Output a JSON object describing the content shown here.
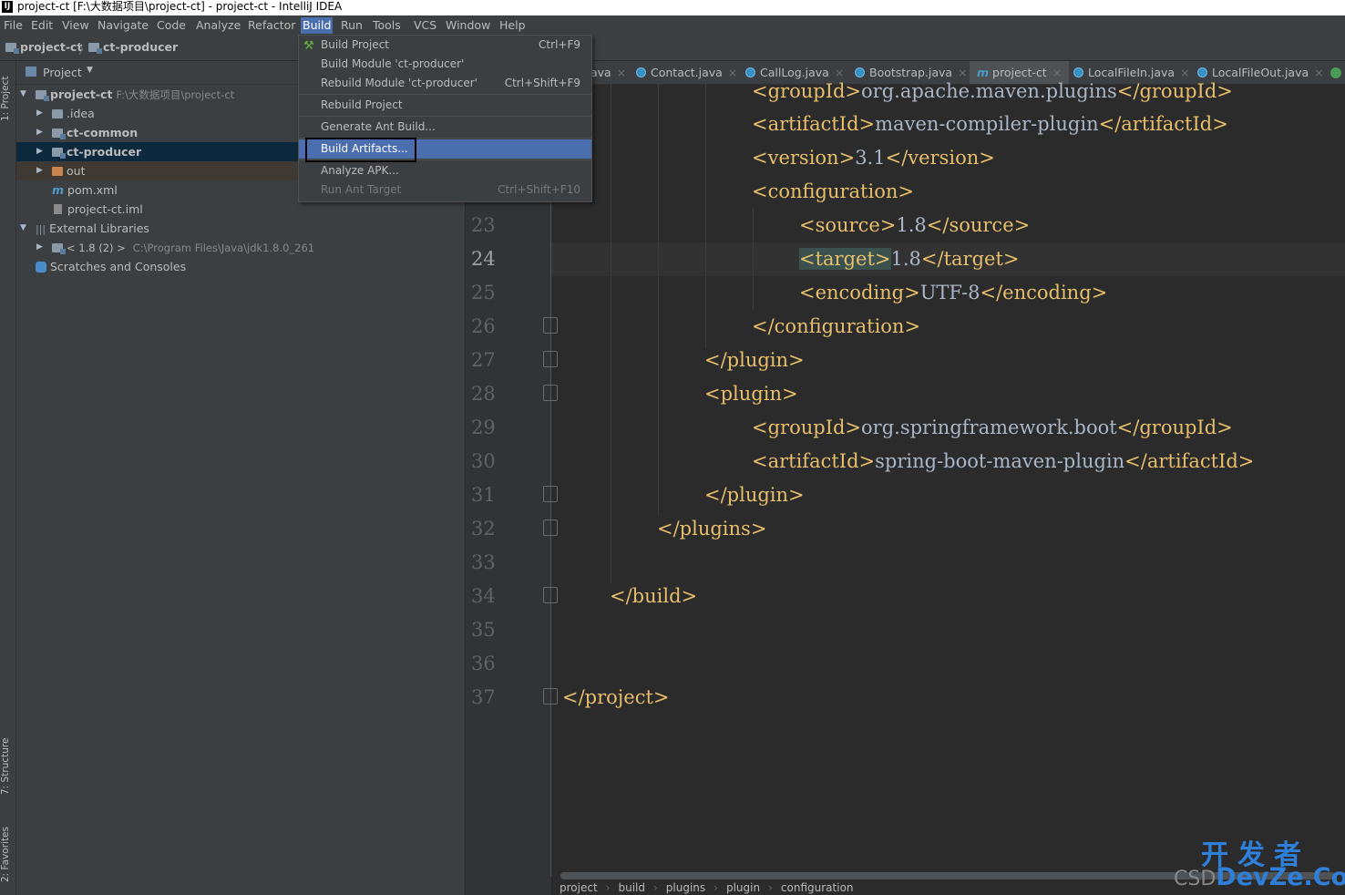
{
  "window": {
    "title": "project-ct [F:\\大数据项目\\project-ct] - project-ct - IntelliJ IDEA",
    "app_icon": "IJ"
  },
  "menubar": [
    "File",
    "Edit",
    "View",
    "Navigate",
    "Code",
    "Analyze",
    "Refactor",
    "Build",
    "Run",
    "Tools",
    "VCS",
    "Window",
    "Help"
  ],
  "breadcrumb": {
    "root": "project-ct",
    "module": "ct-producer",
    "sep": "〉"
  },
  "sidebar": {
    "project_tab": "1: Project",
    "structure_tab": "7: Structure",
    "favorites_tab": "2: Favorites"
  },
  "project_panel": {
    "header": "Project",
    "tree": [
      {
        "label": "project-ct",
        "detail": "F:\\大数据项目\\project-ct"
      },
      {
        "label": ".idea"
      },
      {
        "label": "ct-common"
      },
      {
        "label": "ct-producer"
      },
      {
        "label": "out"
      },
      {
        "label": "pom.xml"
      },
      {
        "label": "project-ct.iml"
      },
      {
        "label": "External Libraries"
      },
      {
        "label": "< 1.8 (2) >",
        "detail": "C:\\Program Files\\Java\\jdk1.8.0_261"
      },
      {
        "label": "Scratches and Consoles"
      }
    ]
  },
  "editor_tabs": [
    {
      "label": "ava"
    },
    {
      "label": "Contact.java"
    },
    {
      "label": "CallLog.java"
    },
    {
      "label": "Bootstrap.java"
    },
    {
      "label": "project-ct",
      "active": true
    },
    {
      "label": "LocalFileIn.java"
    },
    {
      "label": "LocalFileOut.java"
    }
  ],
  "build_menu": [
    {
      "label": "Build Project",
      "shortcut": "Ctrl+F9"
    },
    {
      "label": "Build Module 'ct-producer'",
      "shortcut": ""
    },
    {
      "label": "Rebuild Module 'ct-producer'",
      "shortcut": "Ctrl+Shift+F9"
    },
    {
      "label": "Rebuild Project",
      "shortcut": ""
    },
    {
      "label": "Generate Ant Build...",
      "shortcut": ""
    },
    {
      "label": "Build Artifacts...",
      "shortcut": "",
      "highlighted": true
    },
    {
      "label": "Analyze APK...",
      "shortcut": ""
    },
    {
      "label": "Run Ant Target",
      "shortcut": "Ctrl+Shift+F10",
      "disabled": true
    }
  ],
  "code": {
    "line_numbers": [
      "23",
      "24",
      "25",
      "26",
      "27",
      "28",
      "29",
      "30",
      "31",
      "32",
      "33",
      "34",
      "35",
      "36",
      "37"
    ],
    "current_line": "24",
    "lines": [
      {
        "open": "<groupId>",
        "text": "org.apache.maven.plugins",
        "close": "</groupId>"
      },
      {
        "open": "<artifactId>",
        "text": "maven-compiler-plugin",
        "close": "</artifactId>"
      },
      {
        "open": "<version>",
        "text": "3.1",
        "close": "</version>"
      },
      {
        "open": "<configuration>",
        "text": "",
        "close": ""
      },
      {
        "open": "<source>",
        "text": "1.8",
        "close": "</source>"
      },
      {
        "open": "<target>",
        "text": "1.8",
        "close": "</target>"
      },
      {
        "open": "<encoding>",
        "text": "UTF-8",
        "close": "</encoding>"
      },
      {
        "open": "</configuration>",
        "text": "",
        "close": ""
      },
      {
        "open": "</plugin>",
        "text": "",
        "close": ""
      },
      {
        "open": "<plugin>",
        "text": "",
        "close": ""
      },
      {
        "open": "<groupId>",
        "text": "org.springframework.boot",
        "close": "</groupId>"
      },
      {
        "open": "<artifactId>",
        "text": "spring-boot-maven-plugin",
        "close": "</artifactId>"
      },
      {
        "open": "</plugin>",
        "text": "",
        "close": ""
      },
      {
        "open": "</plugins>",
        "text": "",
        "close": ""
      },
      {
        "open": "</build>",
        "text": "",
        "close": ""
      },
      {
        "open": "</project>",
        "text": "",
        "close": ""
      }
    ]
  },
  "status_breadcrumb": [
    "project",
    "build",
    "plugins",
    "plugin",
    "configuration"
  ],
  "watermark": {
    "line1": "开发者",
    "csd": "CSD",
    "devze": "DevZe.CoM"
  },
  "colors": {
    "accent": "#4b6eaf",
    "tag": "#e8bf6a",
    "text": "#a9b7c6",
    "bg": "#2b2b2b"
  }
}
